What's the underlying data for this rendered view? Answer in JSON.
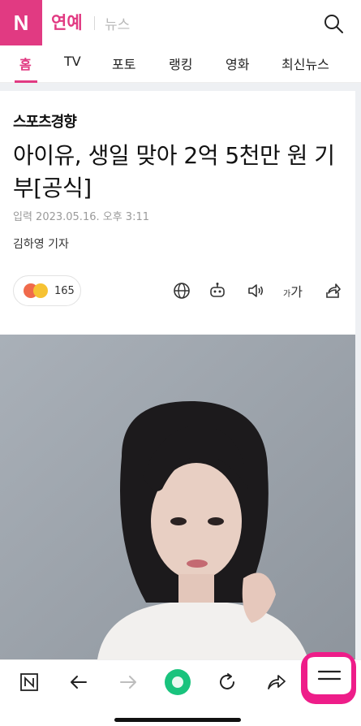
{
  "header": {
    "logo_label": "N",
    "section": "연예",
    "subsection": "뉴스"
  },
  "tabs": [
    {
      "label": "홈",
      "active": true
    },
    {
      "label": "TV",
      "active": false
    },
    {
      "label": "포토",
      "active": false
    },
    {
      "label": "랭킹",
      "active": false
    },
    {
      "label": "영화",
      "active": false
    },
    {
      "label": "최신뉴스",
      "active": false
    }
  ],
  "article": {
    "press": "스포츠경향",
    "headline": "아이유, 생일 맞아 2억 5천만 원 기부[공식]",
    "date": "입력 2023.05.16. 오후 3:11",
    "reporter": "김하영 기자",
    "reaction_count": "165",
    "font_size_label_small": "가",
    "font_size_label_big": "가"
  },
  "toolbar_icons": [
    "globe-icon",
    "robot-summary-icon",
    "speaker-icon",
    "font-size-icon",
    "share-icon"
  ],
  "bottom_bar": {
    "icons": [
      "naver-home-icon",
      "back-arrow-icon",
      "forward-arrow-icon",
      "green-dot-icon",
      "refresh-icon",
      "share-arrow-icon",
      "menu-icon"
    ]
  },
  "colors": {
    "brand": "#e13a82",
    "menu_highlight": "#ee1d89",
    "green_dot": "#19c37d"
  }
}
